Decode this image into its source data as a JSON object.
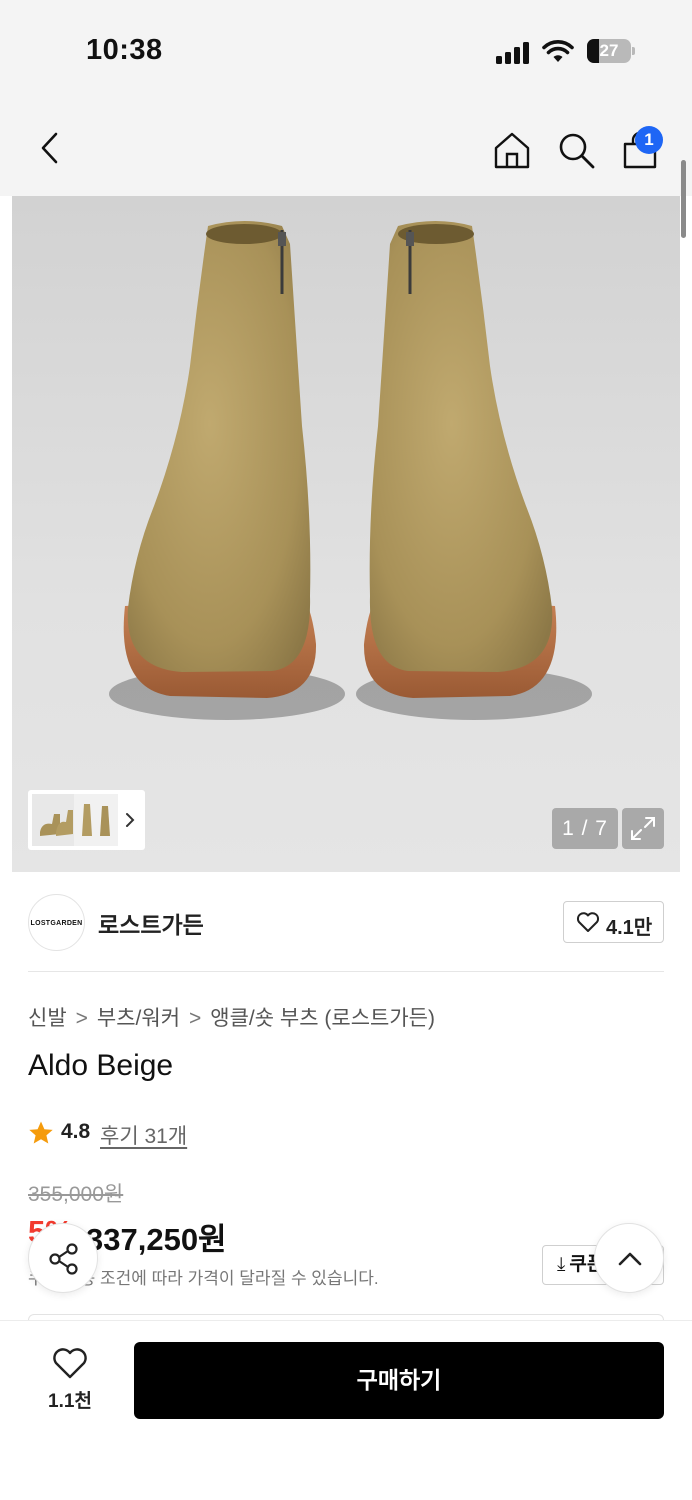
{
  "status_bar": {
    "time": "10:38",
    "battery": "27",
    "battery_level": 0.27
  },
  "header": {
    "cart_badge": "1"
  },
  "gallery": {
    "counter": "1 / 7"
  },
  "brand": {
    "logo_text": "LOSTGARDEN",
    "name": "로스트가든",
    "like_count": "4.1만"
  },
  "breadcrumb": [
    "신발",
    "부츠/워커",
    "앵클/숏 부츠 (로스트가든)"
  ],
  "product": {
    "title": "Aldo Beige",
    "rating": "4.8",
    "review_link": "후기 31개",
    "original_price": "355,000원",
    "discount": "5%",
    "sale_price": "337,250원",
    "price_note": "쿠폰 적용 조건에 따라 가격이 달라질 수 있습니다.",
    "coupon_label": "쿠폰"
  },
  "bottom_bar": {
    "wish_count": "1.1천",
    "buy_label": "구매하기"
  },
  "colors": {
    "accent_blue": "#1e66f5",
    "discount_red": "#f23b2f",
    "star_orange": "#f59b0c",
    "boot_suede": "#b39c62",
    "sole_brown": "#b86f44"
  }
}
